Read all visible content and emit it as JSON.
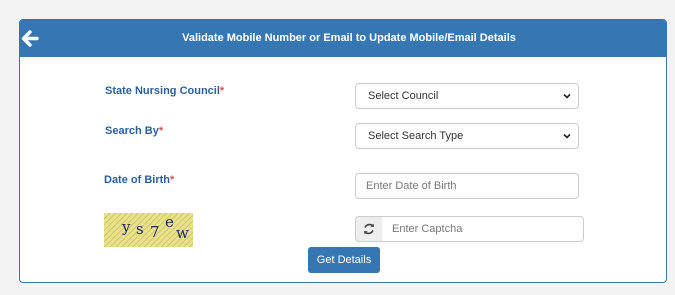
{
  "header": {
    "title": "Validate Mobile Number or Email to Update Mobile/Email Details"
  },
  "form": {
    "council_label": "State Nursing Council",
    "council_value": "Select Council",
    "search_label": "Search By",
    "search_value": "Select Search Type",
    "dob_label": "Date of Birth",
    "dob_placeholder": "Enter Date of Birth",
    "required_mark": "*",
    "captcha_text": "ys7ew",
    "captcha_chars": [
      "y",
      "s",
      "7",
      "e",
      "w"
    ],
    "captcha_placeholder": "Enter Captcha",
    "submit_label": "Get Details"
  },
  "colors": {
    "primary": "#3576b3",
    "label": "#2a5f9e",
    "required": "#d9534f"
  },
  "icons": {
    "back": "arrow-left-icon",
    "refresh": "refresh-icon",
    "dropdown": "chevron-down-icon"
  }
}
